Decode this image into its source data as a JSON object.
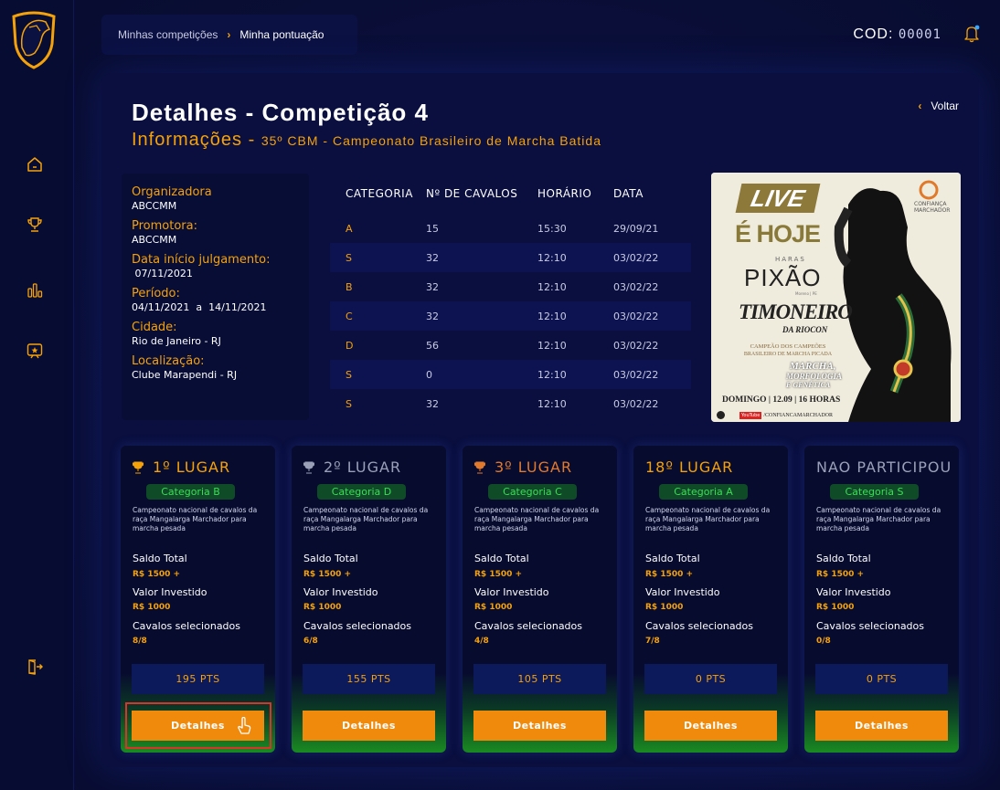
{
  "breadcrumb": {
    "items": [
      "Minhas competições",
      "Minha pontuação"
    ]
  },
  "header": {
    "cod_label": "COD:",
    "cod_value": "00001"
  },
  "page": {
    "title": "Detalhes - Competição 4",
    "subtitle_prefix": "Informações -",
    "subtitle_text": "35º CBM - Campeonato Brasileiro de Marcha Batida",
    "back_label": "Voltar"
  },
  "info": [
    {
      "label": "Organizadora",
      "value": "ABCCMM"
    },
    {
      "label": "Promotora:",
      "value": "ABCCMM"
    },
    {
      "label": "Data início julgamento:",
      "value": " 07/11/2021"
    },
    {
      "label": "Período:",
      "value": "04/11/2021  a  14/11/2021"
    },
    {
      "label": "Cidade:",
      "value": "Rio de Janeiro - RJ"
    },
    {
      "label": "Localização:",
      "value": "Clube Marapendi - RJ"
    }
  ],
  "table": {
    "headers": [
      "CATEGORIA",
      "Nº DE CAVALOS",
      "HORÁRIO",
      "DATA"
    ],
    "rows": [
      [
        "A",
        "15",
        "15:30",
        "29/09/21"
      ],
      [
        "S",
        "32",
        "12:10",
        "03/02/22"
      ],
      [
        "B",
        "32",
        "12:10",
        "03/02/22"
      ],
      [
        "C",
        "32",
        "12:10",
        "03/02/22"
      ],
      [
        "D",
        "56",
        "12:10",
        "03/02/22"
      ],
      [
        "S",
        "0",
        "12:10",
        "03/02/22"
      ],
      [
        "S",
        "32",
        "12:10",
        "03/02/22"
      ]
    ]
  },
  "poster": {
    "live": "LIVE",
    "ehoje": "É HOJE",
    "haras": "HARAS",
    "pixao": "PIXÃO",
    "moreno": "Moreno | PE",
    "timoneiro": "TIMONEIRO",
    "riocon": "DA RIOCON",
    "campeao": "CAMPEÃO DOS CAMPEÕES",
    "brasileiro": "BRASILEIRO DE MARCHA PICADA",
    "marcha": "MARCHA,",
    "morfologia": "MORFOLOGIA",
    "genetica": "E GENÉTICA",
    "domingo": "DOMINGO | 12.09 | 16 HORAS",
    "channel": "/CONFIANCAMARCHADOR",
    "youtube": "YouTube",
    "brand1": "CONFIANÇA",
    "brand2": "MARCHADOR"
  },
  "cards": [
    {
      "place": "1º LUGAR",
      "category": "Categoria B",
      "desc": "Campeonato nacional de cavalos da raça Mangalarga Marchador para marcha pesada",
      "saldo_label": "Saldo Total",
      "saldo": "R$ 1500 +",
      "invest_label": "Valor Investido",
      "invest": "R$ 1000",
      "cavalos_label": "Cavalos selecionados",
      "cavalos": "8/8",
      "pts": "195 PTS",
      "button": "Detalhes"
    },
    {
      "place": "2º LUGAR",
      "category": "Categoria D",
      "desc": "Campeonato nacional de cavalos da raça Mangalarga Marchador para marcha pesada",
      "saldo_label": "Saldo Total",
      "saldo": "R$ 1500 +",
      "invest_label": "Valor Investido",
      "invest": "R$ 1000",
      "cavalos_label": "Cavalos selecionados",
      "cavalos": "6/8",
      "pts": "155 PTS",
      "button": "Detalhes"
    },
    {
      "place": "3º LUGAR",
      "category": "Categoria C",
      "desc": "Campeonato nacional de cavalos da raça Mangalarga Marchador para marcha pesada",
      "saldo_label": "Saldo Total",
      "saldo": "R$ 1500 +",
      "invest_label": "Valor Investido",
      "invest": "R$ 1000",
      "cavalos_label": "Cavalos selecionados",
      "cavalos": "4/8",
      "pts": "105 PTS",
      "button": "Detalhes"
    },
    {
      "place": "18º LUGAR",
      "category": "Categoria A",
      "desc": "Campeonato nacional de cavalos da raça Mangalarga Marchador para marcha pesada",
      "saldo_label": "Saldo Total",
      "saldo": "R$ 1500 +",
      "invest_label": "Valor Investido",
      "invest": "R$ 1000",
      "cavalos_label": "Cavalos selecionados",
      "cavalos": "7/8",
      "pts": "0 PTS",
      "button": "Detalhes"
    },
    {
      "place": "NAO PARTICIPOU",
      "category": "Categoria S",
      "desc": "Campeonato nacional de cavalos da raça Mangalarga Marchador para marcha pesada",
      "saldo_label": "Saldo Total",
      "saldo": "R$ 1500 +",
      "invest_label": "Valor Investido",
      "invest": "R$ 1000",
      "cavalos_label": "Cavalos selecionados",
      "cavalos": "0/8",
      "pts": "0 PTS",
      "button": "Detalhes"
    }
  ],
  "colors": {
    "accent": "#f5a20a",
    "button": "#f08a0c",
    "category_text": "#3ddc5a",
    "first": "#f5a20a",
    "second": "#9aa0b8",
    "third": "#e27a2e"
  }
}
